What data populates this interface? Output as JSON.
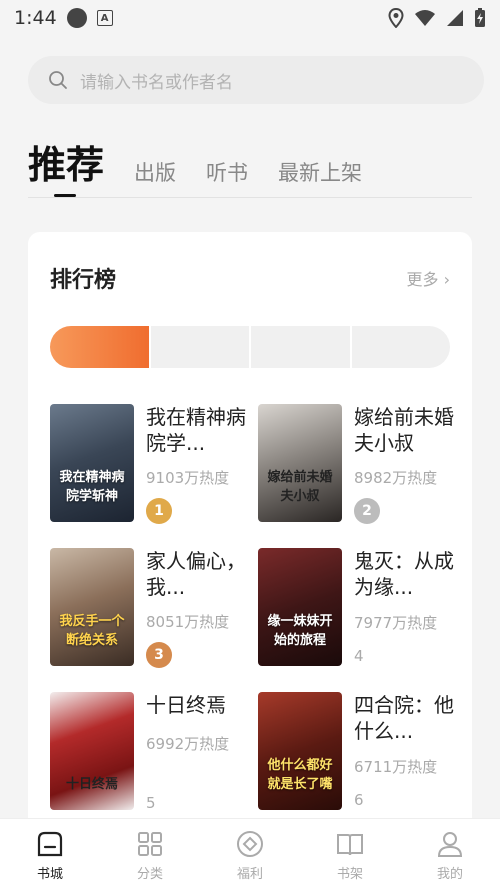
{
  "status_bar": {
    "time": "1:44",
    "notification_letter": "A"
  },
  "search": {
    "placeholder": "请输入书名或作者名"
  },
  "tabs": [
    {
      "label": "推荐",
      "active": true
    },
    {
      "label": "出版",
      "active": false
    },
    {
      "label": "听书",
      "active": false
    },
    {
      "label": "最新上架",
      "active": false
    }
  ],
  "ranking": {
    "title": "排行榜",
    "more": "更多",
    "segments": 4,
    "active_segment": 0,
    "books": [
      {
        "title": "我在精神病院学...",
        "heat": "9103万热度",
        "rank": "1",
        "cover_text": "我在精神病院学斩神",
        "rank_color": "#e0a94a"
      },
      {
        "title": "嫁给前未婚夫小叔",
        "heat": "8982万热度",
        "rank": "2",
        "cover_text": "嫁给前未婚夫小叔",
        "rank_color": "#bcbcbc"
      },
      {
        "title": "家人偏心，我...",
        "heat": "8051万热度",
        "rank": "3",
        "cover_text": "我反手一个断绝关系",
        "rank_color": "#d58a4d"
      },
      {
        "title": "鬼灭：从成为缘...",
        "heat": "7977万热度",
        "rank": "4",
        "cover_text": "缘一妹妹开始的旅程"
      },
      {
        "title": "十日终焉",
        "heat": "6992万热度",
        "rank": "5",
        "cover_text": "十日终焉"
      },
      {
        "title": "四合院：他什么...",
        "heat": "6711万热度",
        "rank": "6",
        "cover_text": "他什么都好就是长了嘴"
      }
    ]
  },
  "bottom_nav": [
    {
      "label": "书城",
      "icon": "home-icon",
      "active": true
    },
    {
      "label": "分类",
      "icon": "grid-icon",
      "active": false
    },
    {
      "label": "福利",
      "icon": "coin-icon",
      "active": false
    },
    {
      "label": "书架",
      "icon": "book-icon",
      "active": false
    },
    {
      "label": "我的",
      "icon": "user-icon",
      "active": false
    }
  ],
  "colors": {
    "accent": "#f06d2f",
    "accent_light": "#f7995a",
    "background": "#f4f4f4",
    "card": "#ffffff"
  }
}
